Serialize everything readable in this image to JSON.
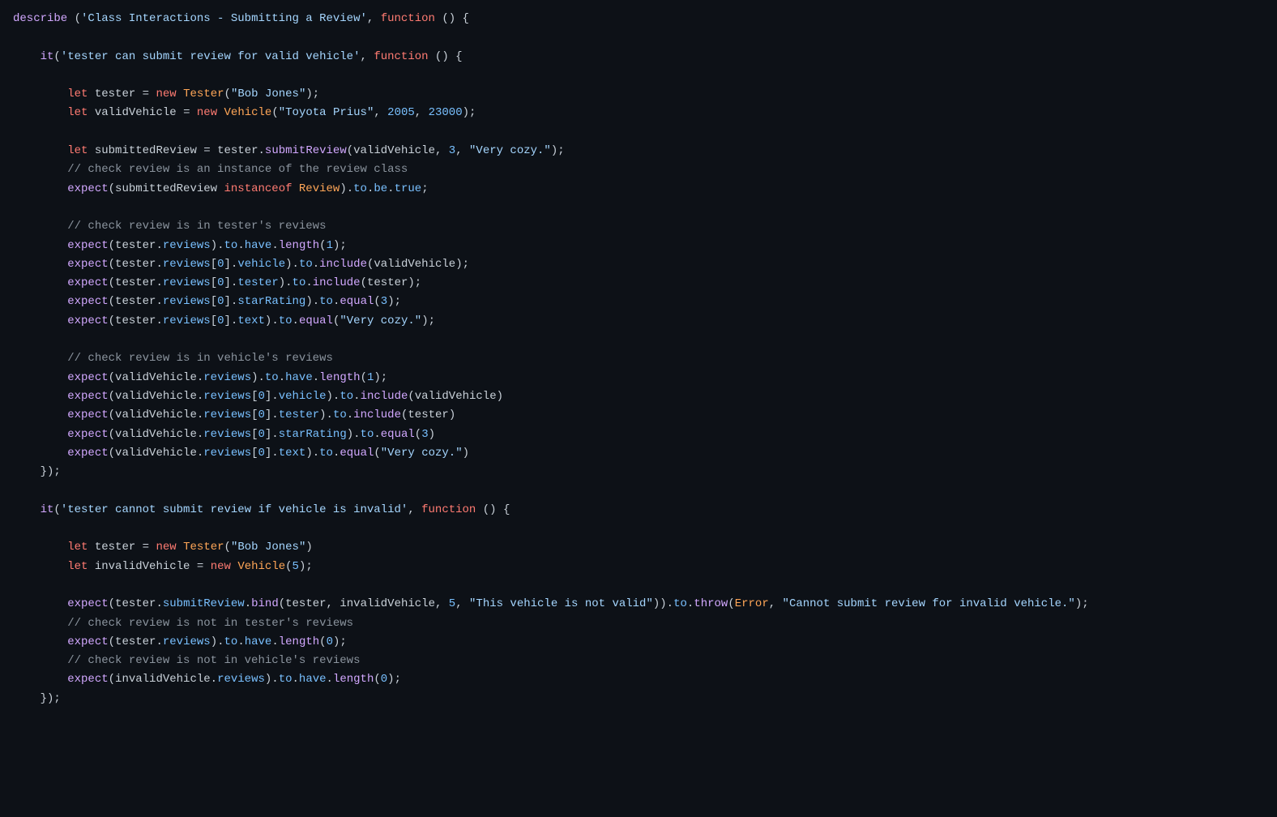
{
  "colors": {
    "background": "#0d1117",
    "keyword": "#ff7b72",
    "function": "#d2a8ff",
    "class": "#ffa657",
    "string": "#a5d6ff",
    "number": "#79c0ff",
    "property": "#79c0ff",
    "comment": "#8b949e",
    "default": "#c9d1d9"
  },
  "code": {
    "lines": [
      [
        [
          "fn",
          "describe"
        ],
        [
          "pn",
          " ("
        ],
        [
          "str",
          "'Class Interactions - Submitting a Review'"
        ],
        [
          "pn",
          ", "
        ],
        [
          "k",
          "function"
        ],
        [
          "pn",
          " () {"
        ]
      ],
      [],
      [
        [
          "pn",
          "    "
        ],
        [
          "fn",
          "it"
        ],
        [
          "pn",
          "("
        ],
        [
          "str",
          "'tester can submit review for valid vehicle'"
        ],
        [
          "pn",
          ", "
        ],
        [
          "k",
          "function"
        ],
        [
          "pn",
          " () {"
        ]
      ],
      [],
      [
        [
          "pn",
          "        "
        ],
        [
          "k",
          "let"
        ],
        [
          "pn",
          " "
        ],
        [
          "id",
          "tester"
        ],
        [
          "pn",
          " = "
        ],
        [
          "k",
          "new"
        ],
        [
          "pn",
          " "
        ],
        [
          "cls",
          "Tester"
        ],
        [
          "pn",
          "("
        ],
        [
          "str",
          "\"Bob Jones\""
        ],
        [
          "pn",
          ");"
        ]
      ],
      [
        [
          "pn",
          "        "
        ],
        [
          "k",
          "let"
        ],
        [
          "pn",
          " "
        ],
        [
          "id",
          "validVehicle"
        ],
        [
          "pn",
          " = "
        ],
        [
          "k",
          "new"
        ],
        [
          "pn",
          " "
        ],
        [
          "cls",
          "Vehicle"
        ],
        [
          "pn",
          "("
        ],
        [
          "str",
          "\"Toyota Prius\""
        ],
        [
          "pn",
          ", "
        ],
        [
          "num",
          "2005"
        ],
        [
          "pn",
          ", "
        ],
        [
          "num",
          "23000"
        ],
        [
          "pn",
          ");"
        ]
      ],
      [],
      [
        [
          "pn",
          "        "
        ],
        [
          "k",
          "let"
        ],
        [
          "pn",
          " "
        ],
        [
          "id",
          "submittedReview"
        ],
        [
          "pn",
          " = "
        ],
        [
          "id",
          "tester"
        ],
        [
          "pn",
          "."
        ],
        [
          "fn",
          "submitReview"
        ],
        [
          "pn",
          "("
        ],
        [
          "id",
          "validVehicle"
        ],
        [
          "pn",
          ", "
        ],
        [
          "num",
          "3"
        ],
        [
          "pn",
          ", "
        ],
        [
          "str",
          "\"Very cozy.\""
        ],
        [
          "pn",
          ");"
        ]
      ],
      [
        [
          "pn",
          "        "
        ],
        [
          "cmt",
          "// check review is an instance of the review class"
        ]
      ],
      [
        [
          "pn",
          "        "
        ],
        [
          "fn",
          "expect"
        ],
        [
          "pn",
          "("
        ],
        [
          "id",
          "submittedReview"
        ],
        [
          "pn",
          " "
        ],
        [
          "k",
          "instanceof"
        ],
        [
          "pn",
          " "
        ],
        [
          "cls",
          "Review"
        ],
        [
          "pn",
          ")."
        ],
        [
          "prop",
          "to"
        ],
        [
          "pn",
          "."
        ],
        [
          "prop",
          "be"
        ],
        [
          "pn",
          "."
        ],
        [
          "prop",
          "true"
        ],
        [
          "pn",
          ";"
        ]
      ],
      [],
      [
        [
          "pn",
          "        "
        ],
        [
          "cmt",
          "// check review is in tester's reviews"
        ]
      ],
      [
        [
          "pn",
          "        "
        ],
        [
          "fn",
          "expect"
        ],
        [
          "pn",
          "("
        ],
        [
          "id",
          "tester"
        ],
        [
          "pn",
          "."
        ],
        [
          "prop",
          "reviews"
        ],
        [
          "pn",
          ")."
        ],
        [
          "prop",
          "to"
        ],
        [
          "pn",
          "."
        ],
        [
          "prop",
          "have"
        ],
        [
          "pn",
          "."
        ],
        [
          "fn",
          "length"
        ],
        [
          "pn",
          "("
        ],
        [
          "num",
          "1"
        ],
        [
          "pn",
          ");"
        ]
      ],
      [
        [
          "pn",
          "        "
        ],
        [
          "fn",
          "expect"
        ],
        [
          "pn",
          "("
        ],
        [
          "id",
          "tester"
        ],
        [
          "pn",
          "."
        ],
        [
          "prop",
          "reviews"
        ],
        [
          "pn",
          "["
        ],
        [
          "num",
          "0"
        ],
        [
          "pn",
          "]."
        ],
        [
          "prop",
          "vehicle"
        ],
        [
          "pn",
          ")."
        ],
        [
          "prop",
          "to"
        ],
        [
          "pn",
          "."
        ],
        [
          "fn",
          "include"
        ],
        [
          "pn",
          "("
        ],
        [
          "id",
          "validVehicle"
        ],
        [
          "pn",
          ");"
        ]
      ],
      [
        [
          "pn",
          "        "
        ],
        [
          "fn",
          "expect"
        ],
        [
          "pn",
          "("
        ],
        [
          "id",
          "tester"
        ],
        [
          "pn",
          "."
        ],
        [
          "prop",
          "reviews"
        ],
        [
          "pn",
          "["
        ],
        [
          "num",
          "0"
        ],
        [
          "pn",
          "]."
        ],
        [
          "prop",
          "tester"
        ],
        [
          "pn",
          ")."
        ],
        [
          "prop",
          "to"
        ],
        [
          "pn",
          "."
        ],
        [
          "fn",
          "include"
        ],
        [
          "pn",
          "("
        ],
        [
          "id",
          "tester"
        ],
        [
          "pn",
          ");"
        ]
      ],
      [
        [
          "pn",
          "        "
        ],
        [
          "fn",
          "expect"
        ],
        [
          "pn",
          "("
        ],
        [
          "id",
          "tester"
        ],
        [
          "pn",
          "."
        ],
        [
          "prop",
          "reviews"
        ],
        [
          "pn",
          "["
        ],
        [
          "num",
          "0"
        ],
        [
          "pn",
          "]."
        ],
        [
          "prop",
          "starRating"
        ],
        [
          "pn",
          ")."
        ],
        [
          "prop",
          "to"
        ],
        [
          "pn",
          "."
        ],
        [
          "fn",
          "equal"
        ],
        [
          "pn",
          "("
        ],
        [
          "num",
          "3"
        ],
        [
          "pn",
          ");"
        ]
      ],
      [
        [
          "pn",
          "        "
        ],
        [
          "fn",
          "expect"
        ],
        [
          "pn",
          "("
        ],
        [
          "id",
          "tester"
        ],
        [
          "pn",
          "."
        ],
        [
          "prop",
          "reviews"
        ],
        [
          "pn",
          "["
        ],
        [
          "num",
          "0"
        ],
        [
          "pn",
          "]."
        ],
        [
          "prop",
          "text"
        ],
        [
          "pn",
          ")."
        ],
        [
          "prop",
          "to"
        ],
        [
          "pn",
          "."
        ],
        [
          "fn",
          "equal"
        ],
        [
          "pn",
          "("
        ],
        [
          "str",
          "\"Very cozy.\""
        ],
        [
          "pn",
          ");"
        ]
      ],
      [],
      [
        [
          "pn",
          "        "
        ],
        [
          "cmt",
          "// check review is in vehicle's reviews"
        ]
      ],
      [
        [
          "pn",
          "        "
        ],
        [
          "fn",
          "expect"
        ],
        [
          "pn",
          "("
        ],
        [
          "id",
          "validVehicle"
        ],
        [
          "pn",
          "."
        ],
        [
          "prop",
          "reviews"
        ],
        [
          "pn",
          ")."
        ],
        [
          "prop",
          "to"
        ],
        [
          "pn",
          "."
        ],
        [
          "prop",
          "have"
        ],
        [
          "pn",
          "."
        ],
        [
          "fn",
          "length"
        ],
        [
          "pn",
          "("
        ],
        [
          "num",
          "1"
        ],
        [
          "pn",
          ");"
        ]
      ],
      [
        [
          "pn",
          "        "
        ],
        [
          "fn",
          "expect"
        ],
        [
          "pn",
          "("
        ],
        [
          "id",
          "validVehicle"
        ],
        [
          "pn",
          "."
        ],
        [
          "prop",
          "reviews"
        ],
        [
          "pn",
          "["
        ],
        [
          "num",
          "0"
        ],
        [
          "pn",
          "]."
        ],
        [
          "prop",
          "vehicle"
        ],
        [
          "pn",
          ")."
        ],
        [
          "prop",
          "to"
        ],
        [
          "pn",
          "."
        ],
        [
          "fn",
          "include"
        ],
        [
          "pn",
          "("
        ],
        [
          "id",
          "validVehicle"
        ],
        [
          "pn",
          ")"
        ]
      ],
      [
        [
          "pn",
          "        "
        ],
        [
          "fn",
          "expect"
        ],
        [
          "pn",
          "("
        ],
        [
          "id",
          "validVehicle"
        ],
        [
          "pn",
          "."
        ],
        [
          "prop",
          "reviews"
        ],
        [
          "pn",
          "["
        ],
        [
          "num",
          "0"
        ],
        [
          "pn",
          "]."
        ],
        [
          "prop",
          "tester"
        ],
        [
          "pn",
          ")."
        ],
        [
          "prop",
          "to"
        ],
        [
          "pn",
          "."
        ],
        [
          "fn",
          "include"
        ],
        [
          "pn",
          "("
        ],
        [
          "id",
          "tester"
        ],
        [
          "pn",
          ")"
        ]
      ],
      [
        [
          "pn",
          "        "
        ],
        [
          "fn",
          "expect"
        ],
        [
          "pn",
          "("
        ],
        [
          "id",
          "validVehicle"
        ],
        [
          "pn",
          "."
        ],
        [
          "prop",
          "reviews"
        ],
        [
          "pn",
          "["
        ],
        [
          "num",
          "0"
        ],
        [
          "pn",
          "]."
        ],
        [
          "prop",
          "starRating"
        ],
        [
          "pn",
          ")."
        ],
        [
          "prop",
          "to"
        ],
        [
          "pn",
          "."
        ],
        [
          "fn",
          "equal"
        ],
        [
          "pn",
          "("
        ],
        [
          "num",
          "3"
        ],
        [
          "pn",
          ")"
        ]
      ],
      [
        [
          "pn",
          "        "
        ],
        [
          "fn",
          "expect"
        ],
        [
          "pn",
          "("
        ],
        [
          "id",
          "validVehicle"
        ],
        [
          "pn",
          "."
        ],
        [
          "prop",
          "reviews"
        ],
        [
          "pn",
          "["
        ],
        [
          "num",
          "0"
        ],
        [
          "pn",
          "]."
        ],
        [
          "prop",
          "text"
        ],
        [
          "pn",
          ")."
        ],
        [
          "prop",
          "to"
        ],
        [
          "pn",
          "."
        ],
        [
          "fn",
          "equal"
        ],
        [
          "pn",
          "("
        ],
        [
          "str",
          "\"Very cozy.\""
        ],
        [
          "pn",
          ")"
        ]
      ],
      [
        [
          "pn",
          "    });"
        ]
      ],
      [],
      [
        [
          "pn",
          "    "
        ],
        [
          "fn",
          "it"
        ],
        [
          "pn",
          "("
        ],
        [
          "str",
          "'tester cannot submit review if vehicle is invalid'"
        ],
        [
          "pn",
          ", "
        ],
        [
          "k",
          "function"
        ],
        [
          "pn",
          " () {"
        ]
      ],
      [],
      [
        [
          "pn",
          "        "
        ],
        [
          "k",
          "let"
        ],
        [
          "pn",
          " "
        ],
        [
          "id",
          "tester"
        ],
        [
          "pn",
          " = "
        ],
        [
          "k",
          "new"
        ],
        [
          "pn",
          " "
        ],
        [
          "cls",
          "Tester"
        ],
        [
          "pn",
          "("
        ],
        [
          "str",
          "\"Bob Jones\""
        ],
        [
          "pn",
          ")"
        ]
      ],
      [
        [
          "pn",
          "        "
        ],
        [
          "k",
          "let"
        ],
        [
          "pn",
          " "
        ],
        [
          "id",
          "invalidVehicle"
        ],
        [
          "pn",
          " = "
        ],
        [
          "k",
          "new"
        ],
        [
          "pn",
          " "
        ],
        [
          "cls",
          "Vehicle"
        ],
        [
          "pn",
          "("
        ],
        [
          "num",
          "5"
        ],
        [
          "pn",
          ");"
        ]
      ],
      [],
      [
        [
          "pn",
          "        "
        ],
        [
          "fn",
          "expect"
        ],
        [
          "pn",
          "("
        ],
        [
          "id",
          "tester"
        ],
        [
          "pn",
          "."
        ],
        [
          "prop",
          "submitReview"
        ],
        [
          "pn",
          "."
        ],
        [
          "fn",
          "bind"
        ],
        [
          "pn",
          "("
        ],
        [
          "id",
          "tester"
        ],
        [
          "pn",
          ", "
        ],
        [
          "id",
          "invalidVehicle"
        ],
        [
          "pn",
          ", "
        ],
        [
          "num",
          "5"
        ],
        [
          "pn",
          ", "
        ],
        [
          "str",
          "\"This vehicle is not valid\""
        ],
        [
          "pn",
          "))."
        ],
        [
          "prop",
          "to"
        ],
        [
          "pn",
          "."
        ],
        [
          "fn",
          "throw"
        ],
        [
          "pn",
          "("
        ],
        [
          "cls",
          "Error"
        ],
        [
          "pn",
          ", "
        ],
        [
          "str",
          "\"Cannot submit review for invalid vehicle.\""
        ],
        [
          "pn",
          ");"
        ]
      ],
      [
        [
          "pn",
          "        "
        ],
        [
          "cmt",
          "// check review is not in tester's reviews"
        ]
      ],
      [
        [
          "pn",
          "        "
        ],
        [
          "fn",
          "expect"
        ],
        [
          "pn",
          "("
        ],
        [
          "id",
          "tester"
        ],
        [
          "pn",
          "."
        ],
        [
          "prop",
          "reviews"
        ],
        [
          "pn",
          ")."
        ],
        [
          "prop",
          "to"
        ],
        [
          "pn",
          "."
        ],
        [
          "prop",
          "have"
        ],
        [
          "pn",
          "."
        ],
        [
          "fn",
          "length"
        ],
        [
          "pn",
          "("
        ],
        [
          "num",
          "0"
        ],
        [
          "pn",
          ");"
        ]
      ],
      [
        [
          "pn",
          "        "
        ],
        [
          "cmt",
          "// check review is not in vehicle's reviews"
        ]
      ],
      [
        [
          "pn",
          "        "
        ],
        [
          "fn",
          "expect"
        ],
        [
          "pn",
          "("
        ],
        [
          "id",
          "invalidVehicle"
        ],
        [
          "pn",
          "."
        ],
        [
          "prop",
          "reviews"
        ],
        [
          "pn",
          ")."
        ],
        [
          "prop",
          "to"
        ],
        [
          "pn",
          "."
        ],
        [
          "prop",
          "have"
        ],
        [
          "pn",
          "."
        ],
        [
          "fn",
          "length"
        ],
        [
          "pn",
          "("
        ],
        [
          "num",
          "0"
        ],
        [
          "pn",
          ");"
        ]
      ],
      [
        [
          "pn",
          "    });"
        ]
      ]
    ]
  }
}
